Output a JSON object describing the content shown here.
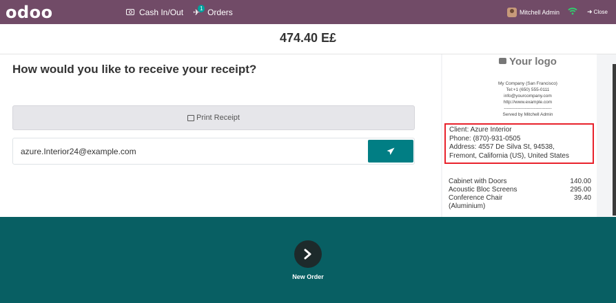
{
  "topbar": {
    "logo": "odoo",
    "cash_label": "Cash In/Out",
    "orders_label": "Orders",
    "orders_badge": "1",
    "user_name": "Mitchell Admin",
    "close_label": "Close",
    "background_color": "#714b67"
  },
  "order": {
    "total": "474.40 E£"
  },
  "receipt_screen": {
    "question": "How would you like to receive your receipt?",
    "print_label": "Print Receipt",
    "email_value": "azure.Interior24@example.com",
    "next_label": "New Order",
    "accent_color": "#017e84",
    "bottom_color": "#085f63"
  },
  "receipt": {
    "logo_text": "Your logo",
    "company_lines": [
      "My Company (San Francisco)",
      "Tel:+1 (650) 555-0111",
      "info@yourcompany.com",
      "http://www.example.com",
      "--------------------------------",
      "Served by Mitchell Admin"
    ],
    "client_lines": [
      "Client: Azure Interior",
      "Phone: (870)-931-0505",
      "Address: 4557 De Silva St, 94538,",
      "Fremont, California (US), United States"
    ],
    "items": [
      {
        "name": "Cabinet with Doors",
        "price": "140.00"
      },
      {
        "name": "Acoustic Bloc Screens",
        "price": "295.00"
      },
      {
        "name": "Conference Chair (Aluminium)",
        "price": "39.40"
      }
    ],
    "highlight_color": "#e8202a"
  }
}
